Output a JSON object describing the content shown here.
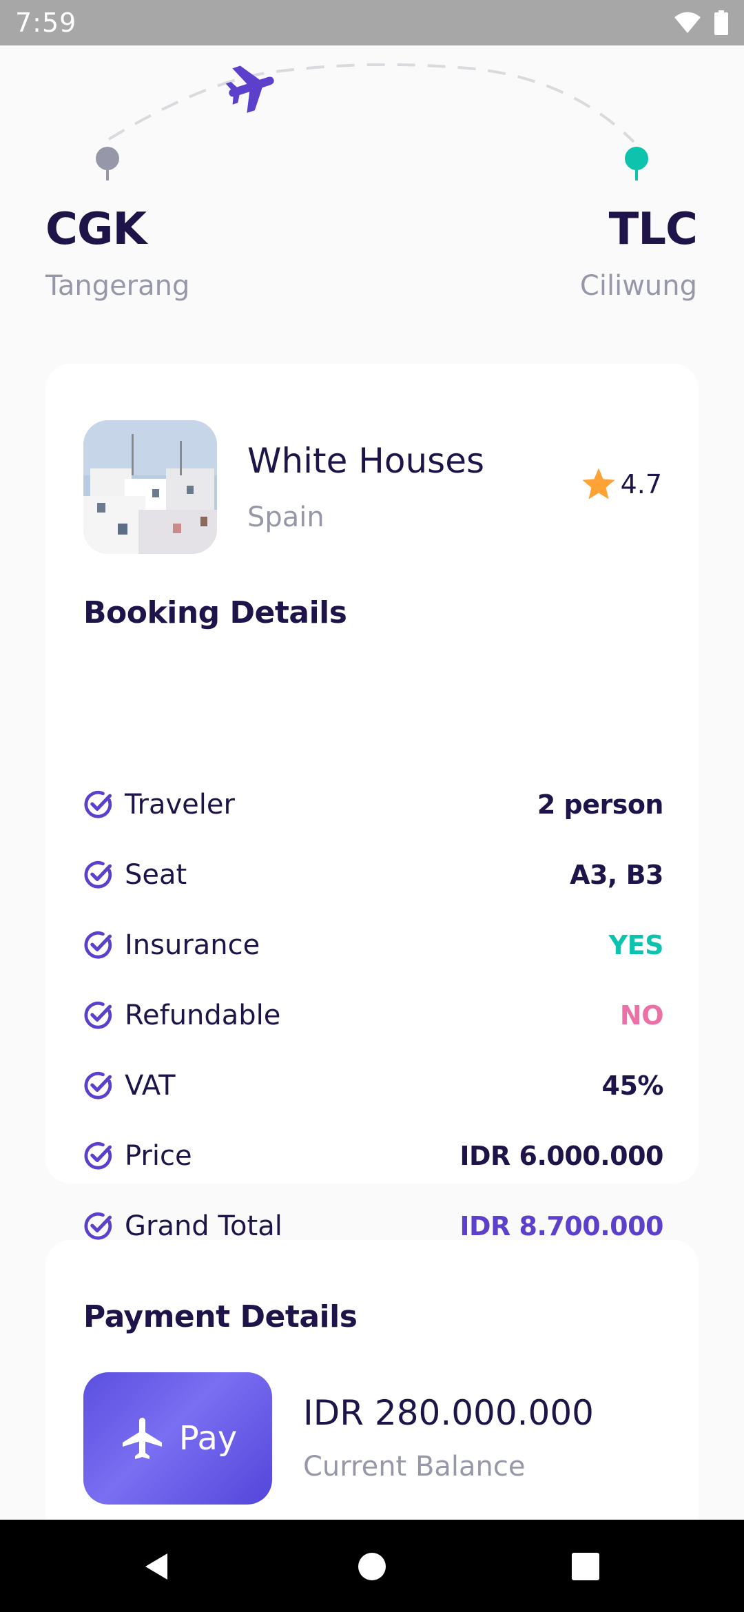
{
  "status_bar": {
    "time": "7:59",
    "icons": [
      "wifi-icon",
      "battery-icon"
    ]
  },
  "route": {
    "from": {
      "code": "CGK",
      "city": "Tangerang"
    },
    "to": {
      "code": "TLC",
      "city": "Ciliwung"
    },
    "icons": [
      "airplane-icon",
      "origin-pin-icon",
      "destination-pin-icon"
    ]
  },
  "destination": {
    "name": "White Houses",
    "country": "Spain",
    "rating": "4.7",
    "icons": [
      "star-icon"
    ]
  },
  "booking": {
    "title": "Booking Details",
    "rows": [
      {
        "label": "Traveler",
        "value": "2 person",
        "color": "#1f1449"
      },
      {
        "label": "Seat",
        "value": "A3, B3",
        "color": "#1f1449"
      },
      {
        "label": "Insurance",
        "value": "YES",
        "color": "#0ec3ae"
      },
      {
        "label": "Refundable",
        "value": "NO",
        "color": "#eb70a5"
      },
      {
        "label": "VAT",
        "value": "45%",
        "color": "#1f1449"
      },
      {
        "label": "Price",
        "value": "IDR 6.000.000",
        "color": "#1f1449"
      },
      {
        "label": "Grand Total",
        "value": "IDR 8.700.000",
        "color": "#5c40cc"
      }
    ]
  },
  "payment": {
    "title": "Payment Details",
    "pay_label": "Pay",
    "balance_amount": "IDR 280.000.000",
    "balance_label": "Current Balance"
  },
  "colors": {
    "primary": "#5c40cc",
    "success": "#0ec3ae",
    "danger": "#eb70a5",
    "star": "#ffa235",
    "text": "#1f1449",
    "muted": "#9698a9"
  },
  "nav": {
    "icons": [
      "back-icon",
      "home-icon",
      "recents-icon"
    ]
  }
}
